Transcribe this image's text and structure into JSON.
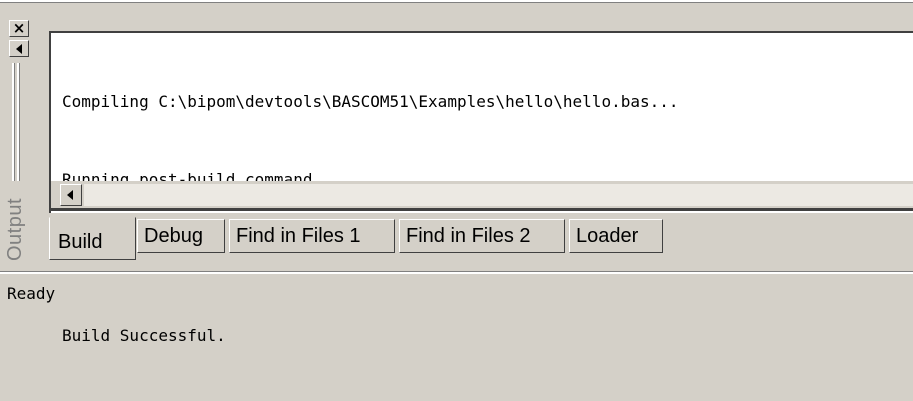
{
  "dock": {
    "title": "Output",
    "close_glyph": "×"
  },
  "output": {
    "lines": [
      "Compiling C:\\bipom\\devtools\\BASCOM51\\Examples\\hello\\hello.bas...",
      "Running post-build command...",
      "",
      "Build Successful."
    ]
  },
  "tabs": [
    {
      "label": "Build",
      "active": true
    },
    {
      "label": "Debug",
      "active": false
    },
    {
      "label": "Find in Files 1",
      "active": false
    },
    {
      "label": "Find in Files 2",
      "active": false
    },
    {
      "label": "Loader",
      "active": false
    }
  ],
  "statusbar": {
    "text": "Ready"
  },
  "colors": {
    "face": "#d4d0c8",
    "shadow": "#404040",
    "highlight": "#ffffff"
  }
}
